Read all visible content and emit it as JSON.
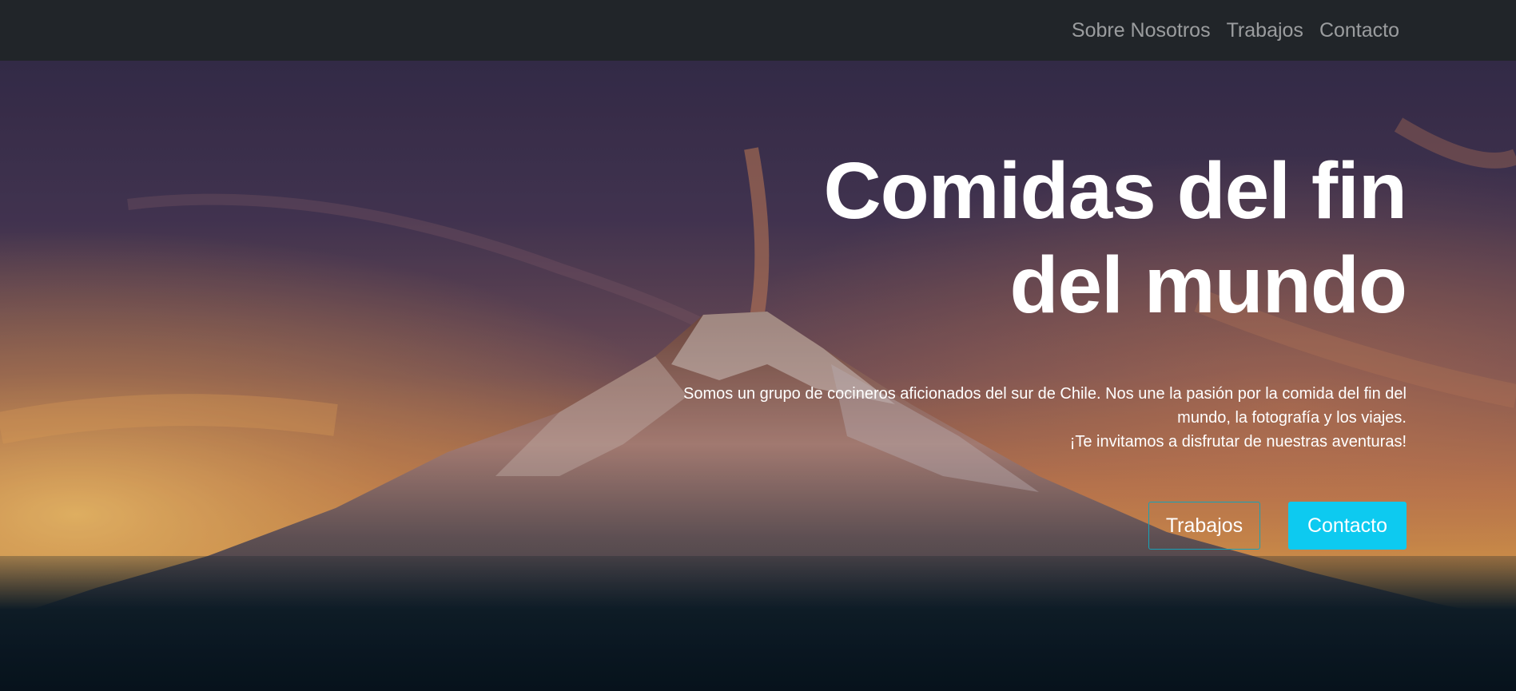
{
  "navbar": {
    "links": [
      "Sobre Nosotros",
      "Trabajos",
      "Contacto"
    ]
  },
  "hero": {
    "title_line1": "Comidas del fin",
    "title_line2": "del mundo",
    "text_line1": "Somos un grupo de cocineros aficionados del sur de Chile. Nos une la pasión por la comida del fin del",
    "text_line2": "mundo, la fotografía y los viajes.",
    "text_line3": "¡Te invitamos a disfrutar de nuestras aventuras!",
    "buttons": {
      "secondary_label": "Trabajos",
      "primary_label": "Contacto"
    }
  },
  "colors": {
    "navbar_bg": "#212529",
    "primary_button": "#0dcaf0",
    "outline_border": "#17a2b8"
  },
  "icons": {
    "hero_background": "volcano-sunset-image"
  }
}
